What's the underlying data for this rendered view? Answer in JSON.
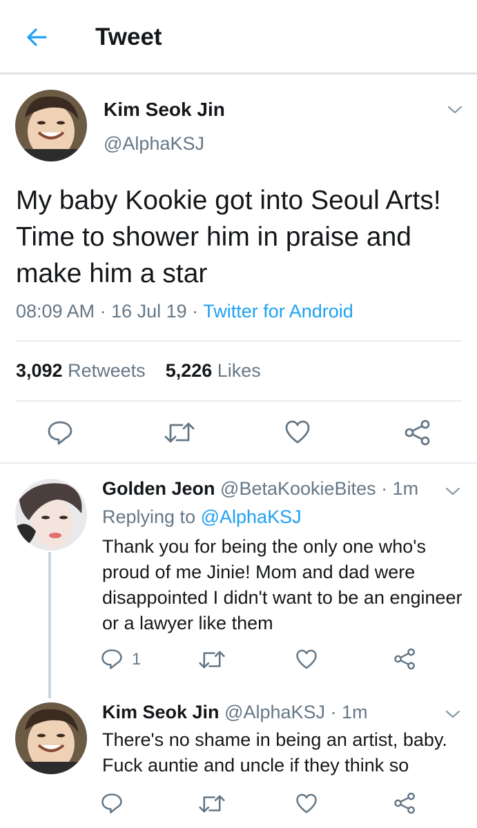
{
  "header": {
    "title": "Tweet"
  },
  "tweet": {
    "name": "Kim Seok Jin",
    "handle": "@AlphaKSJ",
    "text": "My baby Kookie got into Seoul Arts! Time to shower him in praise and make him a star",
    "time": "08:09 AM",
    "dot1": " · ",
    "date": "16 Jul 19",
    "dot2": " · ",
    "source": "Twitter for Android",
    "retweets_count": "3,092",
    "retweets_label": "Retweets",
    "likes_count": "5,226",
    "likes_label": "Likes"
  },
  "replies": [
    {
      "name": "Golden Jeon",
      "handle_time": "@BetaKookieBites · 1m",
      "replying_label": "Replying to",
      "replying_handle": "@AlphaKSJ",
      "text": "Thank you for being the only one who's proud of me Jinie! Mom and dad were disappointed I didn't want to be an engineer or a lawyer like them",
      "reply_count": "1"
    },
    {
      "name": "Kim Seok Jin",
      "handle_time": "@AlphaKSJ · 1m",
      "text": "There's no shame in being an artist, baby. Fuck auntie and uncle if they think so"
    }
  ],
  "colors": {
    "accent": "#1da1f2",
    "muted": "#657786",
    "border": "#e6ecf0"
  },
  "icons": [
    "back-arrow-icon",
    "chevron-down-icon",
    "reply-icon",
    "retweet-icon",
    "like-icon",
    "share-icon"
  ]
}
